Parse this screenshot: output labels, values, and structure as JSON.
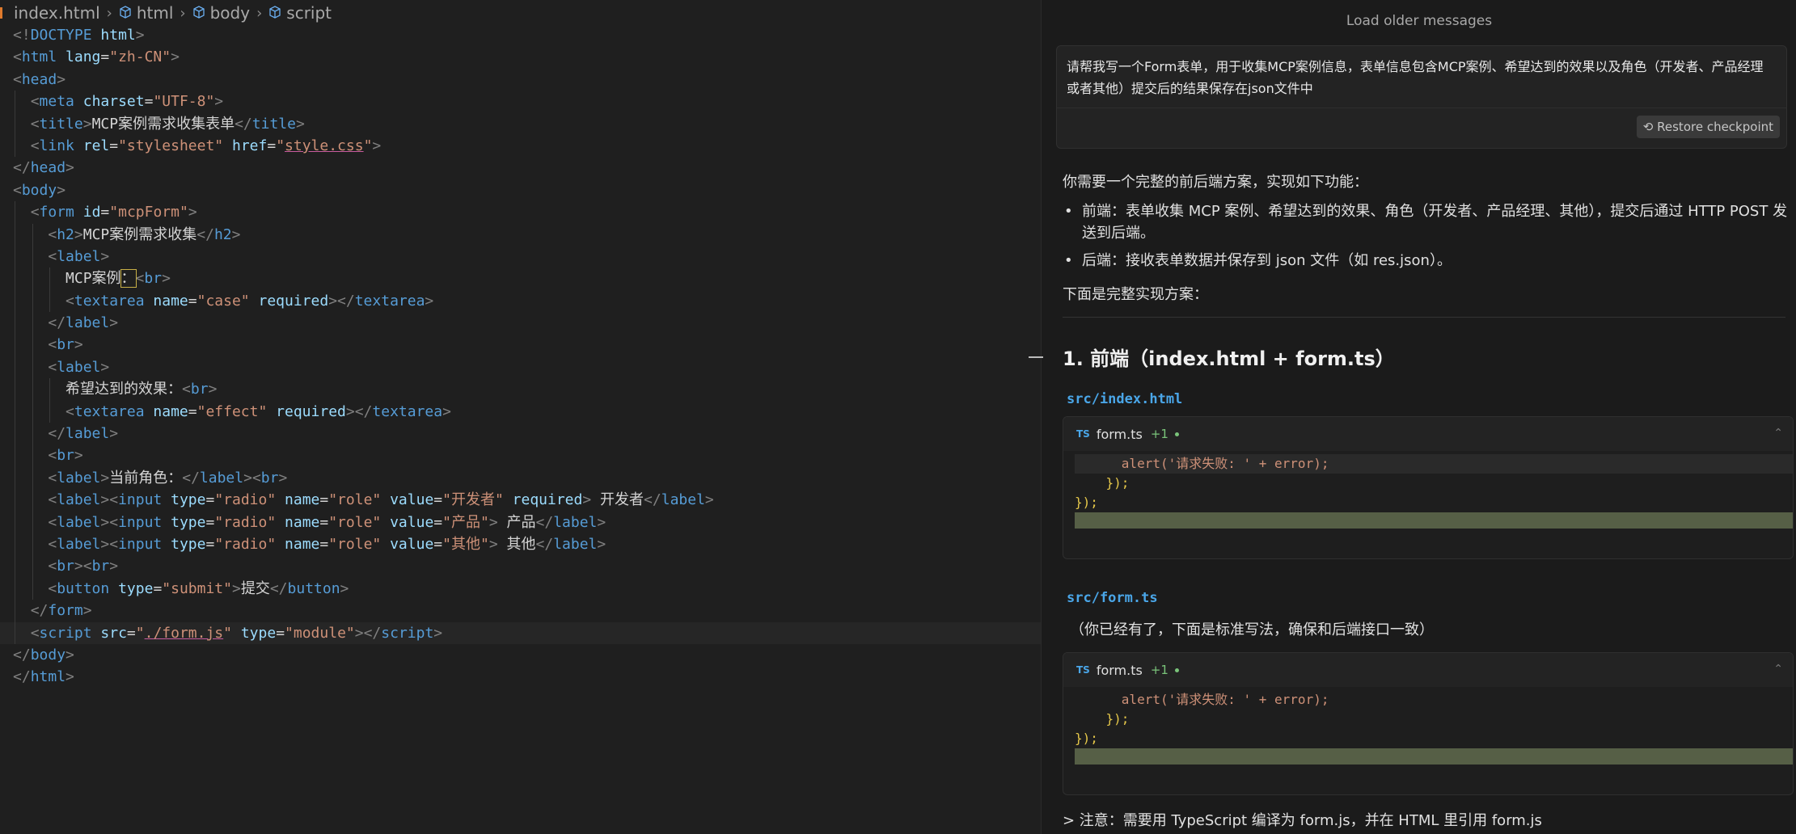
{
  "breadcrumb": {
    "file": "index.html",
    "items": [
      "html",
      "body",
      "script"
    ]
  },
  "code_lines": [
    {
      "indent": 0,
      "parts": [
        [
          "tg",
          "<!"
        ],
        [
          "tn",
          "DOCTYPE"
        ],
        [
          "tx",
          " "
        ],
        [
          "an",
          "html"
        ],
        [
          "tg",
          ">"
        ]
      ]
    },
    {
      "indent": 0,
      "parts": [
        [
          "tg",
          "<"
        ],
        [
          "tn",
          "html"
        ],
        [
          "tx",
          " "
        ],
        [
          "an",
          "lang"
        ],
        [
          "tx",
          "="
        ],
        [
          "av",
          "\"zh-CN\""
        ],
        [
          "tg",
          ">"
        ]
      ]
    },
    {
      "indent": 0,
      "parts": [
        [
          "tg",
          "<"
        ],
        [
          "tn",
          "head"
        ],
        [
          "tg",
          ">"
        ]
      ]
    },
    {
      "indent": 1,
      "parts": [
        [
          "tg",
          "<"
        ],
        [
          "tn",
          "meta"
        ],
        [
          "tx",
          " "
        ],
        [
          "an",
          "charset"
        ],
        [
          "tx",
          "="
        ],
        [
          "av",
          "\"UTF-8\""
        ],
        [
          "tg",
          ">"
        ]
      ]
    },
    {
      "indent": 1,
      "parts": [
        [
          "tg",
          "<"
        ],
        [
          "tn",
          "title"
        ],
        [
          "tg",
          ">"
        ],
        [
          "tx",
          "MCP案例需求收集表单"
        ],
        [
          "tg",
          "</"
        ],
        [
          "tn",
          "title"
        ],
        [
          "tg",
          ">"
        ]
      ]
    },
    {
      "indent": 1,
      "parts": [
        [
          "tg",
          "<"
        ],
        [
          "tn",
          "link"
        ],
        [
          "tx",
          " "
        ],
        [
          "an",
          "rel"
        ],
        [
          "tx",
          "="
        ],
        [
          "av",
          "\"stylesheet\""
        ],
        [
          "tx",
          " "
        ],
        [
          "an",
          "href"
        ],
        [
          "tx",
          "="
        ],
        [
          "av",
          "\""
        ],
        [
          "avu",
          "style.css"
        ],
        [
          "av",
          "\""
        ],
        [
          "tg",
          ">"
        ]
      ]
    },
    {
      "indent": 0,
      "parts": [
        [
          "tg",
          "</"
        ],
        [
          "tn",
          "head"
        ],
        [
          "tg",
          ">"
        ]
      ]
    },
    {
      "indent": 0,
      "parts": [
        [
          "tg",
          "<"
        ],
        [
          "tn",
          "body"
        ],
        [
          "tg",
          ">"
        ]
      ]
    },
    {
      "indent": 1,
      "parts": [
        [
          "tg",
          "<"
        ],
        [
          "tn",
          "form"
        ],
        [
          "tx",
          " "
        ],
        [
          "an",
          "id"
        ],
        [
          "tx",
          "="
        ],
        [
          "av",
          "\"mcpForm\""
        ],
        [
          "tg",
          ">"
        ]
      ]
    },
    {
      "indent": 2,
      "parts": [
        [
          "tg",
          "<"
        ],
        [
          "tn",
          "h2"
        ],
        [
          "tg",
          ">"
        ],
        [
          "tx",
          "MCP案例需求收集"
        ],
        [
          "tg",
          "</"
        ],
        [
          "tn",
          "h2"
        ],
        [
          "tg",
          ">"
        ]
      ]
    },
    {
      "indent": 2,
      "parts": [
        [
          "tg",
          "<"
        ],
        [
          "tn",
          "label"
        ],
        [
          "tg",
          ">"
        ]
      ]
    },
    {
      "indent": 3,
      "parts": [
        [
          "tx",
          "MCP案例"
        ],
        [
          "txc",
          "："
        ],
        [
          "tg",
          "<"
        ],
        [
          "tn",
          "br"
        ],
        [
          "tg",
          ">"
        ]
      ]
    },
    {
      "indent": 3,
      "parts": [
        [
          "tg",
          "<"
        ],
        [
          "tn",
          "textarea"
        ],
        [
          "tx",
          " "
        ],
        [
          "an",
          "name"
        ],
        [
          "tx",
          "="
        ],
        [
          "av",
          "\"case\""
        ],
        [
          "tx",
          " "
        ],
        [
          "an",
          "required"
        ],
        [
          "tg",
          "></"
        ],
        [
          "tn",
          "textarea"
        ],
        [
          "tg",
          ">"
        ]
      ]
    },
    {
      "indent": 2,
      "parts": [
        [
          "tg",
          "</"
        ],
        [
          "tn",
          "label"
        ],
        [
          "tg",
          ">"
        ]
      ]
    },
    {
      "indent": 2,
      "parts": [
        [
          "tg",
          "<"
        ],
        [
          "tn",
          "br"
        ],
        [
          "tg",
          ">"
        ]
      ]
    },
    {
      "indent": 2,
      "parts": [
        [
          "tg",
          "<"
        ],
        [
          "tn",
          "label"
        ],
        [
          "tg",
          ">"
        ]
      ]
    },
    {
      "indent": 3,
      "parts": [
        [
          "tx",
          "希望达到的效果："
        ],
        [
          "tg",
          "<"
        ],
        [
          "tn",
          "br"
        ],
        [
          "tg",
          ">"
        ]
      ]
    },
    {
      "indent": 3,
      "parts": [
        [
          "tg",
          "<"
        ],
        [
          "tn",
          "textarea"
        ],
        [
          "tx",
          " "
        ],
        [
          "an",
          "name"
        ],
        [
          "tx",
          "="
        ],
        [
          "av",
          "\"effect\""
        ],
        [
          "tx",
          " "
        ],
        [
          "an",
          "required"
        ],
        [
          "tg",
          "></"
        ],
        [
          "tn",
          "textarea"
        ],
        [
          "tg",
          ">"
        ]
      ]
    },
    {
      "indent": 2,
      "parts": [
        [
          "tg",
          "</"
        ],
        [
          "tn",
          "label"
        ],
        [
          "tg",
          ">"
        ]
      ]
    },
    {
      "indent": 2,
      "parts": [
        [
          "tg",
          "<"
        ],
        [
          "tn",
          "br"
        ],
        [
          "tg",
          ">"
        ]
      ]
    },
    {
      "indent": 2,
      "parts": [
        [
          "tg",
          "<"
        ],
        [
          "tn",
          "label"
        ],
        [
          "tg",
          ">"
        ],
        [
          "tx",
          "当前角色："
        ],
        [
          "tg",
          "</"
        ],
        [
          "tn",
          "label"
        ],
        [
          "tg",
          "><"
        ],
        [
          "tn",
          "br"
        ],
        [
          "tg",
          ">"
        ]
      ]
    },
    {
      "indent": 2,
      "parts": [
        [
          "tg",
          "<"
        ],
        [
          "tn",
          "label"
        ],
        [
          "tg",
          "><"
        ],
        [
          "tn",
          "input"
        ],
        [
          "tx",
          " "
        ],
        [
          "an",
          "type"
        ],
        [
          "tx",
          "="
        ],
        [
          "av",
          "\"radio\""
        ],
        [
          "tx",
          " "
        ],
        [
          "an",
          "name"
        ],
        [
          "tx",
          "="
        ],
        [
          "av",
          "\"role\""
        ],
        [
          "tx",
          " "
        ],
        [
          "an",
          "value"
        ],
        [
          "tx",
          "="
        ],
        [
          "av",
          "\"开发者\""
        ],
        [
          "tx",
          " "
        ],
        [
          "an",
          "required"
        ],
        [
          "tg",
          ">"
        ],
        [
          "tx",
          " 开发者"
        ],
        [
          "tg",
          "</"
        ],
        [
          "tn",
          "label"
        ],
        [
          "tg",
          ">"
        ]
      ]
    },
    {
      "indent": 2,
      "parts": [
        [
          "tg",
          "<"
        ],
        [
          "tn",
          "label"
        ],
        [
          "tg",
          "><"
        ],
        [
          "tn",
          "input"
        ],
        [
          "tx",
          " "
        ],
        [
          "an",
          "type"
        ],
        [
          "tx",
          "="
        ],
        [
          "av",
          "\"radio\""
        ],
        [
          "tx",
          " "
        ],
        [
          "an",
          "name"
        ],
        [
          "tx",
          "="
        ],
        [
          "av",
          "\"role\""
        ],
        [
          "tx",
          " "
        ],
        [
          "an",
          "value"
        ],
        [
          "tx",
          "="
        ],
        [
          "av",
          "\"产品\""
        ],
        [
          "tg",
          ">"
        ],
        [
          "tx",
          " 产品"
        ],
        [
          "tg",
          "</"
        ],
        [
          "tn",
          "label"
        ],
        [
          "tg",
          ">"
        ]
      ]
    },
    {
      "indent": 2,
      "parts": [
        [
          "tg",
          "<"
        ],
        [
          "tn",
          "label"
        ],
        [
          "tg",
          "><"
        ],
        [
          "tn",
          "input"
        ],
        [
          "tx",
          " "
        ],
        [
          "an",
          "type"
        ],
        [
          "tx",
          "="
        ],
        [
          "av",
          "\"radio\""
        ],
        [
          "tx",
          " "
        ],
        [
          "an",
          "name"
        ],
        [
          "tx",
          "="
        ],
        [
          "av",
          "\"role\""
        ],
        [
          "tx",
          " "
        ],
        [
          "an",
          "value"
        ],
        [
          "tx",
          "="
        ],
        [
          "av",
          "\"其他\""
        ],
        [
          "tg",
          ">"
        ],
        [
          "tx",
          " 其他"
        ],
        [
          "tg",
          "</"
        ],
        [
          "tn",
          "label"
        ],
        [
          "tg",
          ">"
        ]
      ]
    },
    {
      "indent": 2,
      "parts": [
        [
          "tg",
          "<"
        ],
        [
          "tn",
          "br"
        ],
        [
          "tg",
          "><"
        ],
        [
          "tn",
          "br"
        ],
        [
          "tg",
          ">"
        ]
      ]
    },
    {
      "indent": 2,
      "parts": [
        [
          "tg",
          "<"
        ],
        [
          "tn",
          "button"
        ],
        [
          "tx",
          " "
        ],
        [
          "an",
          "type"
        ],
        [
          "tx",
          "="
        ],
        [
          "av",
          "\"submit\""
        ],
        [
          "tg",
          ">"
        ],
        [
          "tx",
          "提交"
        ],
        [
          "tg",
          "</"
        ],
        [
          "tn",
          "button"
        ],
        [
          "tg",
          ">"
        ]
      ]
    },
    {
      "indent": 1,
      "parts": [
        [
          "tg",
          "</"
        ],
        [
          "tn",
          "form"
        ],
        [
          "tg",
          ">"
        ]
      ]
    },
    {
      "indent": 1,
      "cur": true,
      "parts": [
        [
          "tg",
          "<"
        ],
        [
          "tn",
          "script"
        ],
        [
          "tx",
          " "
        ],
        [
          "an",
          "src"
        ],
        [
          "tx",
          "="
        ],
        [
          "av",
          "\""
        ],
        [
          "avu",
          "./form.js"
        ],
        [
          "av",
          "\""
        ],
        [
          "tx",
          " "
        ],
        [
          "an",
          "type"
        ],
        [
          "tx",
          "="
        ],
        [
          "av",
          "\"module\""
        ],
        [
          "tg",
          "></"
        ],
        [
          "tn",
          "script"
        ],
        [
          "tg",
          ">"
        ]
      ]
    },
    {
      "indent": 0,
      "parts": [
        [
          "tg",
          "</"
        ],
        [
          "tn",
          "body"
        ],
        [
          "tg",
          ">"
        ]
      ]
    },
    {
      "indent": 0,
      "parts": [
        [
          "tg",
          "</"
        ],
        [
          "tn",
          "html"
        ],
        [
          "tg",
          ">"
        ]
      ]
    }
  ],
  "chat": {
    "load_older": "Load older messages",
    "user_message": "请帮我写一个Form表单，用于收集MCP案例信息，表单信息包含MCP案例、希望达到的效果以及角色（开发者、产品经理或者其他）提交后的结果保存在json文件中",
    "restore_label": "Restore checkpoint",
    "intro": "你需要一个完整的前后端方案，实现如下功能：",
    "bullet1": "前端：表单收集 MCP 案例、希望达到的效果、角色（开发者、产品经理、其他），提交后通过 HTTP POST 发送到后端。",
    "bullet2": "后端：接收表单数据并保存到 json 文件（如 res.json）。",
    "below": "下面是完整实现方案：",
    "heading": "1. 前端（index.html + form.ts）",
    "path1": "src/index.html",
    "path2": "src/form.ts",
    "note2": "（你已经有了，下面是标准写法，确保和后端接口一致）",
    "block_file": "form.ts",
    "block_badge": "TS",
    "block_diff": "+1",
    "code_a": "alert('",
    "code_b": "请求失败: ' + error);",
    "code_l2": "});",
    "code_l3": "});",
    "footnote": "> 注意：需要用 TypeScript 编译为 form.js，并在 HTML 里引用 form.js"
  }
}
